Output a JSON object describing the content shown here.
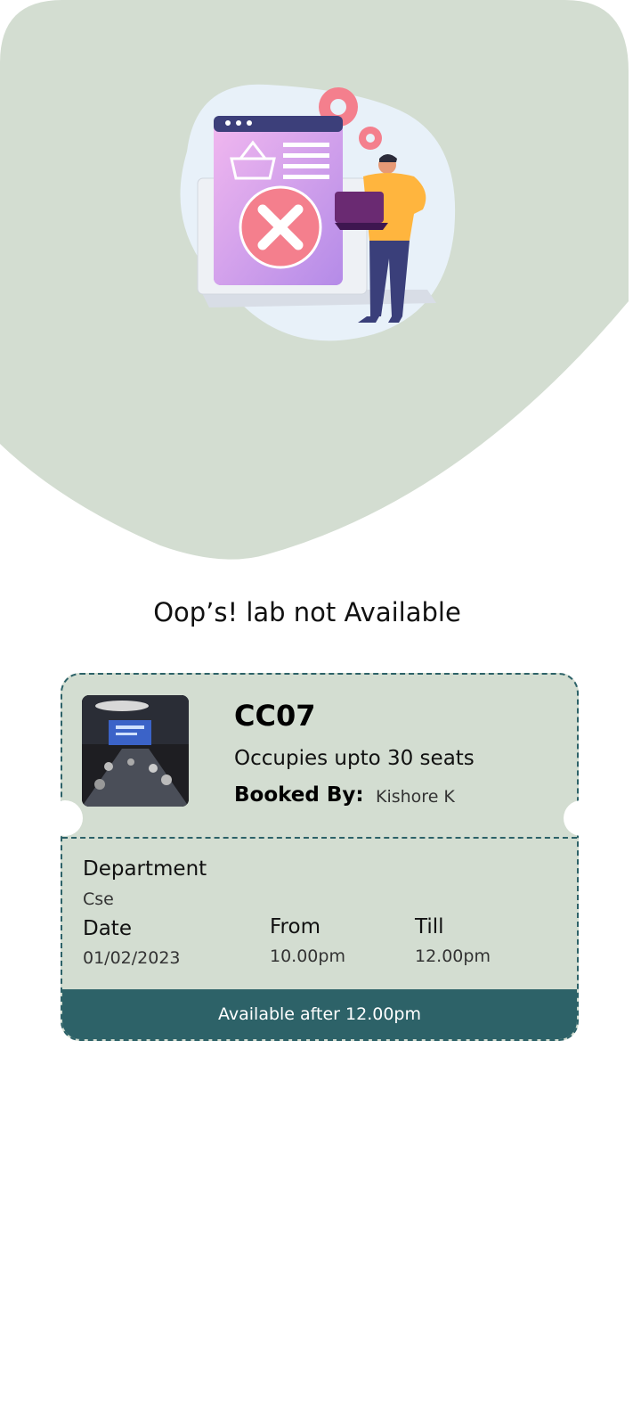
{
  "message": "Oop’s! lab not Available",
  "lab": {
    "code": "CC07",
    "capacity_text": "Occupies upto 30 seats",
    "booked_by_label": "Booked By:",
    "booked_by_value": "Kishore K"
  },
  "details": {
    "department_label": "Department",
    "department_value": "Cse",
    "date_label": "Date",
    "date_value": "01/02/2023",
    "from_label": "From",
    "from_value": "10.00pm",
    "till_label": "Till",
    "till_value": "12.00pm"
  },
  "footer": {
    "status": "Available after 12.00pm"
  },
  "colors": {
    "blob": "#d3ddd1",
    "ticket_bg": "#d3ddd1",
    "accent": "#2d6268"
  },
  "icons": {
    "illustration": "unavailable-illustration",
    "thumbnail": "lab-thumbnail-image"
  }
}
